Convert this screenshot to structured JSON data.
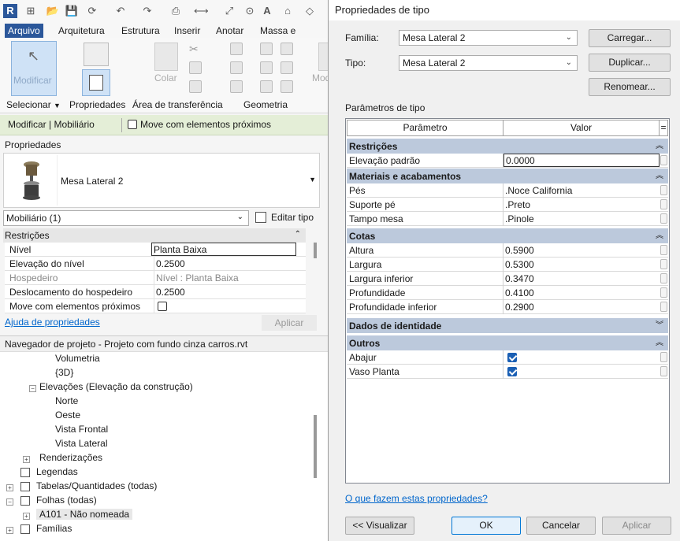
{
  "revit": {
    "tabs": [
      "Arquivo",
      "Arquitetura",
      "Estrutura",
      "Inserir",
      "Anotar",
      "Massa e terreno"
    ],
    "ribbon": {
      "modify_label": "Modificar",
      "color_label": "Colar",
      "mod_label": "Mod",
      "panels": [
        "Selecionar",
        "Propriedades",
        "Área de transferência",
        "Geometria"
      ]
    },
    "context_bar": {
      "title": "Modificar | Mobiliário",
      "move_label": "Move com elementos próximos"
    },
    "properties": {
      "title": "Propriedades",
      "type_name": "Mesa Lateral 2",
      "filter": "Mobiliário (1)",
      "edit_type": "Editar tipo",
      "section": "Restrições",
      "rows": [
        {
          "k": "Nível",
          "v": "Planta Baixa"
        },
        {
          "k": "Elevação do nível",
          "v": "0.2500"
        },
        {
          "k": "Hospedeiro",
          "v": "Nível : Planta Baixa"
        },
        {
          "k": "Deslocamento do hospedeiro",
          "v": "0.2500"
        },
        {
          "k": "Move com elementos próximos",
          "v": ""
        }
      ],
      "help_link": "Ajuda de propriedades",
      "apply": "Aplicar"
    },
    "navigator": {
      "title": "Navegador de projeto - Projeto com fundo cinza carros.rvt",
      "items": [
        "Volumetria",
        "{3D}",
        "Elevações (Elevação da construção)",
        "Norte",
        "Oeste",
        "Vista Frontal",
        "Vista Lateral",
        "Renderizações",
        "Legendas",
        "Tabelas/Quantidades (todas)",
        "Folhas (todas)",
        "A101 - Não nomeada",
        "Famílias"
      ]
    }
  },
  "dialog": {
    "title": "Propriedades de tipo",
    "family_label": "Família:",
    "family_value": "Mesa Lateral 2",
    "type_label": "Tipo:",
    "type_value": "Mesa Lateral 2",
    "load_btn": "Carregar...",
    "duplicate_btn": "Duplicar...",
    "rename_btn": "Renomear...",
    "params_label": "Parâmetros de tipo",
    "col_param": "Parâmetro",
    "col_value": "Valor",
    "col_eq": "=",
    "groups": {
      "restr": "Restrições",
      "mat": "Materiais e acabamentos",
      "cotas": "Cotas",
      "ident": "Dados de identidade",
      "outros": "Outros"
    },
    "rows": {
      "elev": {
        "k": "Elevação padrão",
        "v": "0.0000"
      },
      "pes": {
        "k": "Pés",
        "v": ".Noce California"
      },
      "suporte": {
        "k": "Suporte pé",
        "v": ".Preto"
      },
      "tampo": {
        "k": "Tampo mesa",
        "v": ".Pinole"
      },
      "altura": {
        "k": "Altura",
        "v": "0.5900"
      },
      "largura": {
        "k": "Largura",
        "v": "0.5300"
      },
      "largura_inf": {
        "k": "Largura inferior",
        "v": "0.3470"
      },
      "prof": {
        "k": "Profundidade",
        "v": "0.4100"
      },
      "prof_inf": {
        "k": "Profundidade inferior",
        "v": "0.2900"
      },
      "abajur": {
        "k": "Abajur"
      },
      "vaso": {
        "k": "Vaso Planta"
      }
    },
    "help_link": "O que fazem estas propriedades?",
    "preview_btn": "<< Visualizar",
    "ok_btn": "OK",
    "cancel_btn": "Cancelar",
    "apply_btn": "Aplicar"
  },
  "colors": {
    "accent": "#2b579a",
    "group_header": "#bcc9dc",
    "context_bar": "#e4eed7",
    "checkbox": "#1a5fb4"
  }
}
